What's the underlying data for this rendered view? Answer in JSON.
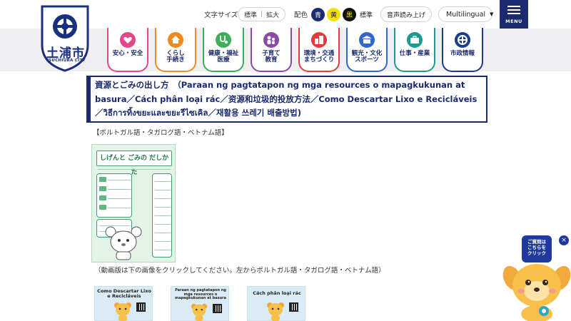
{
  "site": {
    "city_name": "土浦市",
    "city_name_en": "TSUCHIURA CITY"
  },
  "header": {
    "font_size_label": "文字サイズ",
    "font_size_standard": "標準",
    "font_size_large": "拡大",
    "color_label": "配色",
    "color_blue": "青",
    "color_yellow": "黄",
    "color_black": "黒",
    "color_standard": "標準",
    "read_aloud": "音声読み上げ",
    "language": "Multilingual",
    "menu": "MENU"
  },
  "nav": [
    {
      "label": "安心・安全",
      "icon": "heart-hands-icon"
    },
    {
      "label": "くらし\n手続き",
      "icon": "house-icon"
    },
    {
      "label": "健康・福祉\n医療",
      "icon": "stethoscope-icon"
    },
    {
      "label": "子育て\n教育",
      "icon": "family-icon"
    },
    {
      "label": "環境・交通\nまちづくり",
      "icon": "buildings-icon"
    },
    {
      "label": "観光・文化\nスポーツ",
      "icon": "castle-icon"
    },
    {
      "label": "仕事・産業",
      "icon": "briefcase-icon"
    },
    {
      "label": "市政情報",
      "icon": "city-emblem-icon"
    }
  ],
  "page": {
    "title": "資源とごみの出し方　（Paraan ng pagtatapon ng mga resources o mapagkukunan at basura／Cách phân loại rác／资源和垃圾的投放方法／Como Descartar Lixo e Recicláveis／วิธีการทิ้งขยะและขยะรีไซเคิล／재활용 쓰레기 배출방법)",
    "languages_note": "【ポルトガル語・タガログ語・ベトナム語】",
    "video_note": "（動画版は下の画像をクリックしてください。左からポルトガル語・タガログ語・ベトナム語）"
  },
  "brochure": {
    "title": "しげんと ごみの だしかた"
  },
  "videos": [
    {
      "caption": "Como Descartar Lixo e Recicláveis"
    },
    {
      "caption": "Paraan ng pagtatapon ng mga resources o mapagkukunan at basura"
    },
    {
      "caption": "Cách phân loại rác"
    }
  ],
  "helper": {
    "bubble": "ご質問は\nこちらを\nクリック",
    "close": "×"
  },
  "colors": {
    "brand": "#1b2a6e",
    "nav_pink": "#e5458a",
    "nav_orange": "#ef8a1f",
    "nav_green": "#3fae5b",
    "nav_purple": "#8b4aa3",
    "nav_red": "#e23b3b",
    "nav_blue": "#2f69c9",
    "nav_teal": "#1d9a8f",
    "nav_navy": "#1b3a8a"
  }
}
